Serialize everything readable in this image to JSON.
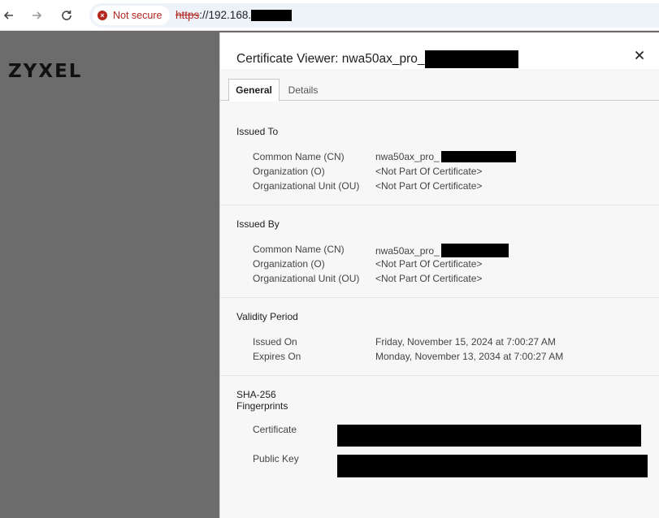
{
  "browser": {
    "security_chip": "Not secure",
    "url_scheme": "https",
    "url_rest": "://192.168."
  },
  "page": {
    "logo": "ZYXEL"
  },
  "dialog": {
    "title": "Certificate Viewer: nwa50ax_pro_",
    "tabs": [
      {
        "label": "General"
      },
      {
        "label": "Details"
      }
    ],
    "issued_to": {
      "heading": "Issued To",
      "rows": [
        {
          "label": "Common Name (CN)",
          "value": "nwa50ax_pro_"
        },
        {
          "label": "Organization (O)",
          "value": "<Not Part Of Certificate>"
        },
        {
          "label": "Organizational Unit (OU)",
          "value": "<Not Part Of Certificate>"
        }
      ]
    },
    "issued_by": {
      "heading": "Issued By",
      "rows": [
        {
          "label": "Common Name (CN)",
          "value": "nwa50ax_pro_"
        },
        {
          "label": "Organization (O)",
          "value": "<Not Part Of Certificate>"
        },
        {
          "label": "Organizational Unit (OU)",
          "value": "<Not Part Of Certificate>"
        }
      ]
    },
    "validity": {
      "heading": "Validity Period",
      "rows": [
        {
          "label": "Issued On",
          "value": "Friday, November 15, 2024 at 7:00:27 AM"
        },
        {
          "label": "Expires On",
          "value": "Monday, November 13, 2034 at 7:00:27 AM"
        }
      ]
    },
    "fingerprints": {
      "heading_line1": "SHA-256",
      "heading_line2": "Fingerprints",
      "rows": [
        {
          "label": "Certificate"
        },
        {
          "label": "Public Key"
        }
      ]
    }
  }
}
